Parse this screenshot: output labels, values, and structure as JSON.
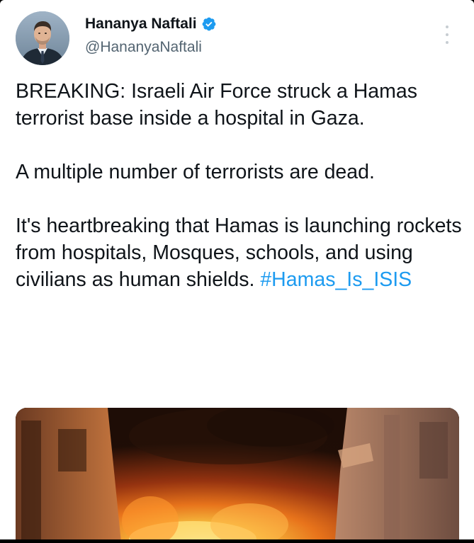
{
  "author": {
    "display_name": "Hananya Naftali",
    "handle": "@HananyaNaftali",
    "verified": true,
    "avatar_icon": "profile-photo"
  },
  "tweet": {
    "paragraph_1": "BREAKING: Israeli Air Force struck a Hamas terrorist base inside a hospital in Gaza.",
    "paragraph_2": "A multiple number of terrorists are dead.",
    "paragraph_3_text": "It's heartbreaking that Hamas is launching rockets from hospitals, Mosques, schools, and using civilians as human shields. ",
    "hashtag": "#Hamas_Is_ISIS"
  },
  "colors": {
    "verified_badge": "#1d9bf0",
    "hashtag": "#1d9bf0",
    "handle": "#536471",
    "text": "#0f1419"
  },
  "icons": {
    "more": "more-vertical-icon",
    "verified": "verified-badge-icon"
  }
}
